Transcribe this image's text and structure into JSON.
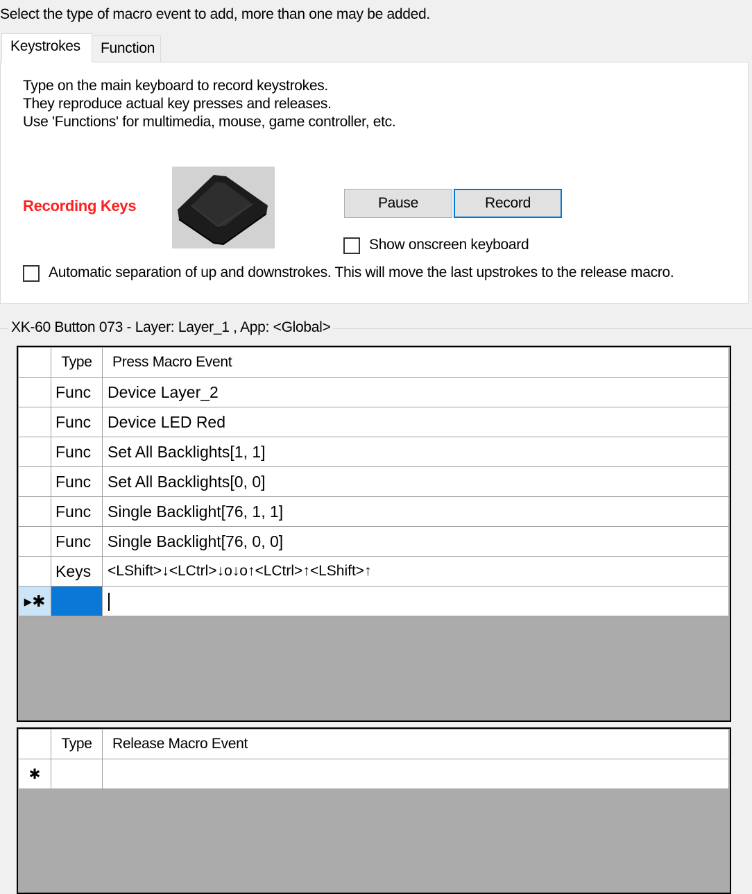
{
  "instruction": "Select the type of macro event to add, more than one may be added.",
  "tabs": [
    {
      "label": "Keystrokes",
      "active": true
    },
    {
      "label": "Function",
      "active": false
    }
  ],
  "keystrokes_panel": {
    "description": [
      "Type on the main keyboard to record keystrokes.",
      "They reproduce actual key presses and releases.",
      "Use 'Functions' for multimedia, mouse, game controller, etc."
    ],
    "recording_label": "Recording Keys",
    "recording_color": "#ff2020",
    "keycap_icon": "keycap-icon",
    "pause_label": "Pause",
    "record_label": "Record",
    "show_keyboard_label": "Show onscreen keyboard",
    "show_keyboard_checked": false,
    "auto_separation_label": "Automatic separation of up and downstrokes. This will move the last upstrokes to the release macro.",
    "auto_separation_checked": false
  },
  "group_title": "XK-60 Button 073 - Layer: Layer_1 , App: <Global>",
  "press_grid": {
    "headers": [
      "Type",
      "Press Macro Event"
    ],
    "rows": [
      {
        "type": "Func",
        "event": "Device Layer_2"
      },
      {
        "type": "Func",
        "event": "Device LED Red"
      },
      {
        "type": "Func",
        "event": "Set All Backlights[1, 1]"
      },
      {
        "type": "Func",
        "event": "Set All Backlights[0, 0]"
      },
      {
        "type": "Func",
        "event": "Single Backlight[76, 1, 1]"
      },
      {
        "type": "Func",
        "event": "Single Backlight[76, 0, 0]"
      },
      {
        "type": "Keys",
        "event": "<LShift>↓<LCtrl>↓o↓o↑<LCtrl>↑<LShift>↑"
      }
    ],
    "new_row_marker": "▸✱"
  },
  "release_grid": {
    "headers": [
      "Type",
      "Release Macro Event"
    ],
    "rows": [],
    "new_row_marker": "✱"
  },
  "colors": {
    "selection": "#0a78d7",
    "current_row_header": "#cce4f7",
    "grid_background": "#ababab",
    "default_button_border": "#0078d7"
  }
}
